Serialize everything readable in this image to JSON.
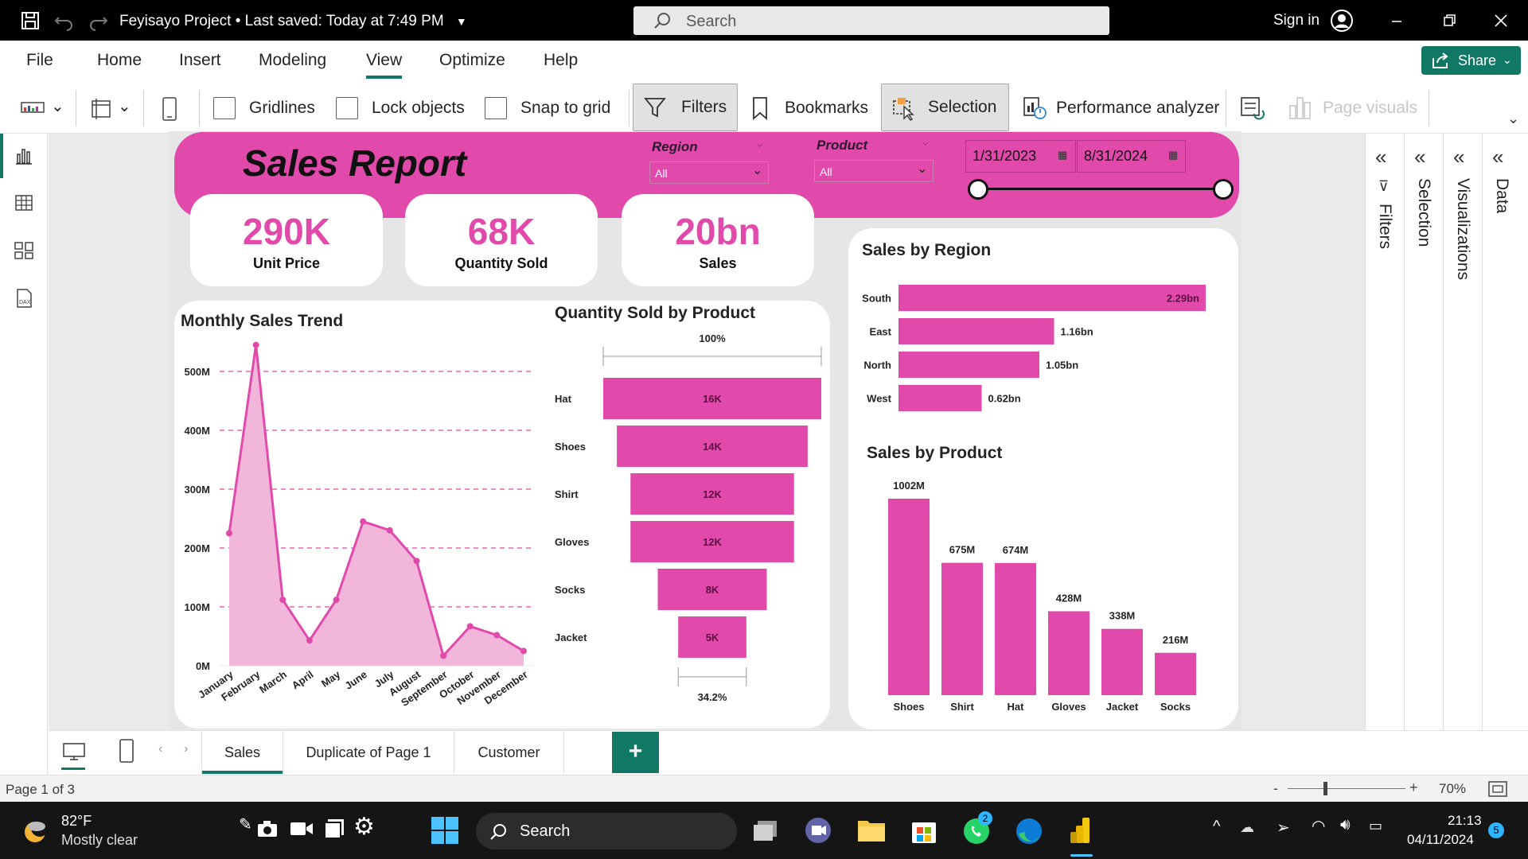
{
  "titlebar": {
    "title": "Feyisayo Project",
    "saved": "Last saved: Today at 7:49 PM",
    "search_placeholder": "Search",
    "sign_in": "Sign in"
  },
  "menu": {
    "items": [
      "File",
      "Home",
      "Insert",
      "Modeling",
      "View",
      "Optimize",
      "Help"
    ],
    "active": "View",
    "share_label": "Share"
  },
  "ribbon": {
    "gridlines": "Gridlines",
    "lock_objects": "Lock objects",
    "snap_to_grid": "Snap to grid",
    "filters": "Filters",
    "bookmarks": "Bookmarks",
    "selection": "Selection",
    "performance_analyzer": "Performance analyzer",
    "page_visuals": "Page visuals"
  },
  "report": {
    "title": "Sales Report",
    "slicers": {
      "region_label": "Region",
      "region_value": "All",
      "product_label": "Product",
      "product_value": "All",
      "date_start": "1/31/2023",
      "date_end": "8/31/2024"
    },
    "kpis": [
      {
        "value": "290K",
        "label": "Unit Price"
      },
      {
        "value": "68K",
        "label": "Quantity Sold"
      },
      {
        "value": "20bn",
        "label": "Sales"
      }
    ]
  },
  "chart_data": [
    {
      "type": "area",
      "title": "Monthly Sales Trend",
      "categories": [
        "January",
        "February",
        "March",
        "April",
        "May",
        "June",
        "July",
        "August",
        "September",
        "October",
        "November",
        "December"
      ],
      "values": [
        225,
        545,
        112,
        43,
        112,
        245,
        230,
        178,
        17,
        67,
        52,
        25
      ],
      "unit": "M",
      "ylim": [
        0,
        500
      ],
      "yticks": [
        "0M",
        "100M",
        "200M",
        "300M",
        "400M",
        "500M"
      ],
      "grid": true,
      "color": "#e149ab"
    },
    {
      "type": "funnel",
      "title": "Quantity Sold by Product",
      "categories": [
        "Hat",
        "Shoes",
        "Shirt",
        "Gloves",
        "Socks",
        "Jacket"
      ],
      "values": [
        16,
        14,
        12,
        12,
        8,
        5
      ],
      "labels": [
        "16K",
        "14K",
        "12K",
        "12K",
        "8K",
        "5K"
      ],
      "top_pct": "100%",
      "bottom_pct": "34.2%",
      "color": "#e149ab"
    },
    {
      "type": "bar",
      "orientation": "horizontal",
      "title": "Sales by Region",
      "categories": [
        "South",
        "East",
        "North",
        "West"
      ],
      "values": [
        2.29,
        1.16,
        1.05,
        0.62
      ],
      "labels": [
        "2.29bn",
        "1.16bn",
        "1.05bn",
        "0.62bn"
      ],
      "color": "#e149ab"
    },
    {
      "type": "bar",
      "title": "Sales by Product",
      "categories": [
        "Shoes",
        "Shirt",
        "Hat",
        "Gloves",
        "Jacket",
        "Socks"
      ],
      "values": [
        1002,
        675,
        674,
        428,
        338,
        216
      ],
      "labels": [
        "1002M",
        "675M",
        "674M",
        "428M",
        "338M",
        "216M"
      ],
      "color": "#e149ab"
    }
  ],
  "panes": [
    "Filters",
    "Selection",
    "Visualizations",
    "Data"
  ],
  "pages": {
    "tabs": [
      "Sales",
      "Duplicate of Page 1",
      "Customer"
    ],
    "active": "Sales",
    "add_label": "+"
  },
  "status": {
    "page": "Page 1 of 3",
    "zoom": "70%"
  },
  "taskbar": {
    "temp": "82°F",
    "weather": "Mostly clear",
    "search_placeholder": "Search",
    "time": "21:13",
    "date": "04/11/2024",
    "notif_count": "5",
    "whatsapp_badge": "2"
  }
}
